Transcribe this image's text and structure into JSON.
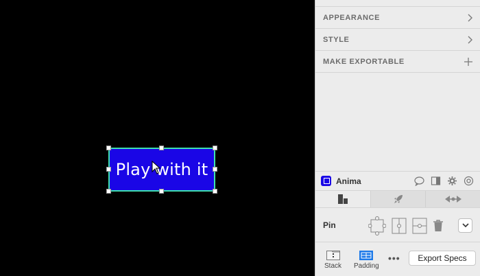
{
  "canvas": {
    "button_label": "Play with it",
    "button_fill": "#1a06e6",
    "selection_color": "#3fe1b0"
  },
  "inspector": {
    "sections": [
      {
        "label": "APPEARANCE",
        "icon": "chevron-right-icon"
      },
      {
        "label": "STYLE",
        "icon": "chevron-right-icon"
      },
      {
        "label": "MAKE EXPORTABLE",
        "icon": "plus-icon"
      }
    ]
  },
  "anima": {
    "name": "Anima",
    "brand_color": "#1a06e6",
    "tool_icons": [
      "comment-icon",
      "panel-toggle-icon",
      "gear-icon",
      "help-icon"
    ],
    "tabs": [
      "layout-icon",
      "rocket-icon",
      "link-icon"
    ],
    "pin_label": "Pin",
    "bottom": {
      "stack_label": "Stack",
      "padding_label": "Padding",
      "export_label": "Export Specs"
    }
  }
}
